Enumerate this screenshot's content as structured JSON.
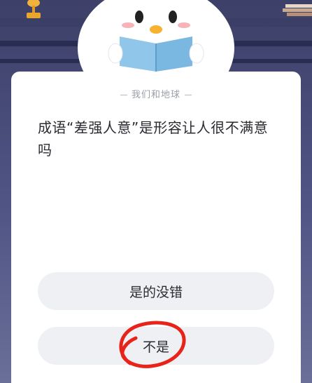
{
  "quiz": {
    "source": "我们和地球",
    "question": "成语“差强人意”是形容让人很不满意吗",
    "options": [
      {
        "label": "是的没错"
      },
      {
        "label": "不是"
      }
    ]
  },
  "colors": {
    "background": "#4a4f7c",
    "card": "#ffffff",
    "option_bg": "#eef0f4",
    "annotation": "#e8231a"
  }
}
